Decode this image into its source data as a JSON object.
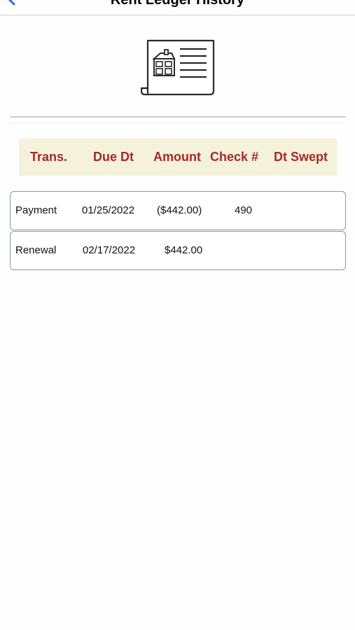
{
  "nav": {
    "title": "Rent Ledger History"
  },
  "header": {
    "columns": [
      "Trans.",
      "Due Dt",
      "Amount",
      "Check #",
      "Dt Swept"
    ]
  },
  "rows": [
    {
      "trans": "Payment",
      "due_dt": "01/25/2022",
      "amount": "($442.00)",
      "check": "490",
      "dt_swept": ""
    },
    {
      "trans": "Renewal",
      "due_dt": "02/17/2022",
      "amount": "$442.00",
      "check": "",
      "dt_swept": ""
    }
  ],
  "colors": {
    "header_text": "#a52a2a",
    "header_bg": "#f4f2db",
    "row_border": "#8a97ab",
    "accent": "#1a73e8"
  },
  "icons": {
    "back": "chevron-left-icon",
    "document": "house-document-icon"
  }
}
